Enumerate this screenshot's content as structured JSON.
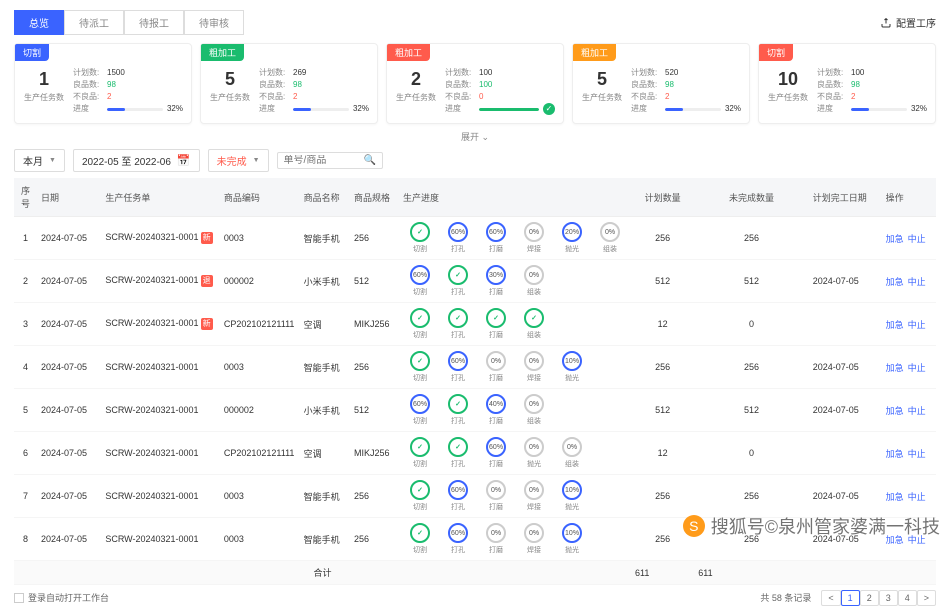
{
  "tabs": [
    "总览",
    "待派工",
    "待报工",
    "待审核"
  ],
  "config_label": "配置工序",
  "cards": [
    {
      "badge": "切割",
      "color": "blue",
      "num": "1",
      "sub": "生产任务数",
      "plan": "1500",
      "good": "98",
      "bad": "2",
      "pct": "32%",
      "width": "32%"
    },
    {
      "badge": "粗加工",
      "color": "green",
      "num": "5",
      "sub": "生产任务数",
      "plan": "269",
      "good": "98",
      "bad": "2",
      "pct": "32%",
      "width": "32%"
    },
    {
      "badge": "粗加工",
      "color": "red",
      "num": "2",
      "sub": "生产任务数",
      "plan": "100",
      "good": "100",
      "bad": "0",
      "pct": "",
      "width": "100%",
      "done": true
    },
    {
      "badge": "粗加工",
      "color": "orange",
      "num": "5",
      "sub": "生产任务数",
      "plan": "520",
      "good": "98",
      "bad": "2",
      "pct": "32%",
      "width": "32%"
    },
    {
      "badge": "切割",
      "color": "red",
      "num": "10",
      "sub": "生产任务数",
      "plan": "100",
      "good": "98",
      "bad": "2",
      "pct": "32%",
      "width": "32%"
    }
  ],
  "card_labels": {
    "plan": "计划数:",
    "good": "良品数:",
    "bad": "不良品:",
    "prog": "进度"
  },
  "expand": "展开 ⌄",
  "filters": {
    "month": "本月",
    "range": "2022-05 至 2022-06",
    "status": "未完成",
    "search_ph": "单号/商品"
  },
  "headers": [
    "序号",
    "日期",
    "生产任务单",
    "商品编码",
    "商品名称",
    "商品规格",
    "生产进度",
    "计划数量",
    "未完成数量",
    "计划完工日期",
    "操作"
  ],
  "rows": [
    {
      "n": "1",
      "date": "2024-07-05",
      "task": "SCRW-20240321-0001",
      "flag": "新",
      "code": "0003",
      "name": "智能手机",
      "spec": "256",
      "steps": [
        {
          "t": "✓",
          "c": "green",
          "l": "切割"
        },
        {
          "t": "60%",
          "c": "blue",
          "l": "打孔"
        },
        {
          "t": "60%",
          "c": "blue",
          "l": "打磨"
        },
        {
          "t": "0%",
          "c": "gray",
          "l": "焊接"
        },
        {
          "t": "20%",
          "c": "blue",
          "l": "抛光"
        },
        {
          "t": "0%",
          "c": "gray",
          "l": "组装"
        }
      ],
      "plan": "256",
      "undone": "256",
      "due": ""
    },
    {
      "n": "2",
      "date": "2024-07-05",
      "task": "SCRW-20240321-0001",
      "flag": "退",
      "code": "000002",
      "name": "小米手机",
      "spec": "512",
      "steps": [
        {
          "t": "60%",
          "c": "blue",
          "l": "切割"
        },
        {
          "t": "✓",
          "c": "green",
          "l": "打孔"
        },
        {
          "t": "30%",
          "c": "blue",
          "l": "打磨"
        },
        {
          "t": "0%",
          "c": "gray",
          "l": "组装"
        }
      ],
      "plan": "512",
      "undone": "512",
      "due": "2024-07-05"
    },
    {
      "n": "3",
      "date": "2024-07-05",
      "task": "SCRW-20240321-0001",
      "flag": "新",
      "code": "CP202102121111",
      "name": "空调",
      "spec": "MIKJ256",
      "steps": [
        {
          "t": "✓",
          "c": "green",
          "l": "切割"
        },
        {
          "t": "✓",
          "c": "green",
          "l": "打孔"
        },
        {
          "t": "✓",
          "c": "green",
          "l": "打磨"
        },
        {
          "t": "✓",
          "c": "green",
          "l": "组装"
        }
      ],
      "plan": "12",
      "undone": "0",
      "due": ""
    },
    {
      "n": "4",
      "date": "2024-07-05",
      "task": "SCRW-20240321-0001",
      "code": "0003",
      "name": "智能手机",
      "spec": "256",
      "steps": [
        {
          "t": "✓",
          "c": "green",
          "l": "切割"
        },
        {
          "t": "60%",
          "c": "blue",
          "l": "打孔"
        },
        {
          "t": "0%",
          "c": "gray",
          "l": "打磨"
        },
        {
          "t": "0%",
          "c": "gray",
          "l": "焊接"
        },
        {
          "t": "10%",
          "c": "blue",
          "l": "抛光"
        }
      ],
      "plan": "256",
      "undone": "256",
      "due": "2024-07-05"
    },
    {
      "n": "5",
      "date": "2024-07-05",
      "task": "SCRW-20240321-0001",
      "code": "000002",
      "name": "小米手机",
      "spec": "512",
      "steps": [
        {
          "t": "60%",
          "c": "blue",
          "l": "切割"
        },
        {
          "t": "✓",
          "c": "green",
          "l": "打孔"
        },
        {
          "t": "40%",
          "c": "blue",
          "l": "打磨"
        },
        {
          "t": "0%",
          "c": "gray",
          "l": "组装"
        }
      ],
      "plan": "512",
      "undone": "512",
      "due": "2024-07-05"
    },
    {
      "n": "6",
      "date": "2024-07-05",
      "task": "SCRW-20240321-0001",
      "code": "CP202102121111",
      "name": "空调",
      "spec": "MIKJ256",
      "steps": [
        {
          "t": "✓",
          "c": "green",
          "l": "切割"
        },
        {
          "t": "✓",
          "c": "green",
          "l": "打孔"
        },
        {
          "t": "60%",
          "c": "blue",
          "l": "打磨"
        },
        {
          "t": "0%",
          "c": "gray",
          "l": "抛光"
        },
        {
          "t": "0%",
          "c": "gray",
          "l": "组装"
        }
      ],
      "plan": "12",
      "undone": "0",
      "due": ""
    },
    {
      "n": "7",
      "date": "2024-07-05",
      "task": "SCRW-20240321-0001",
      "code": "0003",
      "name": "智能手机",
      "spec": "256",
      "steps": [
        {
          "t": "✓",
          "c": "green",
          "l": "切割"
        },
        {
          "t": "60%",
          "c": "blue",
          "l": "打孔"
        },
        {
          "t": "0%",
          "c": "gray",
          "l": "打磨"
        },
        {
          "t": "0%",
          "c": "gray",
          "l": "焊接"
        },
        {
          "t": "10%",
          "c": "blue",
          "l": "抛光"
        }
      ],
      "plan": "256",
      "undone": "256",
      "due": "2024-07-05"
    },
    {
      "n": "8",
      "date": "2024-07-05",
      "task": "SCRW-20240321-0001",
      "code": "0003",
      "name": "智能手机",
      "spec": "256",
      "steps": [
        {
          "t": "✓",
          "c": "green",
          "l": "切割"
        },
        {
          "t": "60%",
          "c": "blue",
          "l": "打孔"
        },
        {
          "t": "0%",
          "c": "gray",
          "l": "打磨"
        },
        {
          "t": "0%",
          "c": "gray",
          "l": "焊接"
        },
        {
          "t": "10%",
          "c": "blue",
          "l": "抛光"
        }
      ],
      "plan": "256",
      "undone": "256",
      "due": "2024-07-05"
    }
  ],
  "ops": {
    "urgent": "加急",
    "stop": "中止"
  },
  "total": {
    "label": "合计",
    "plan": "611",
    "undone": "611"
  },
  "footer": {
    "auto": "登录自动打开工作台",
    "total": "共 58 条记录",
    "pages": [
      "<",
      "1",
      "2",
      "3",
      "4",
      ">"
    ]
  },
  "watermark": "搜狐号©泉州管家婆满一科技"
}
